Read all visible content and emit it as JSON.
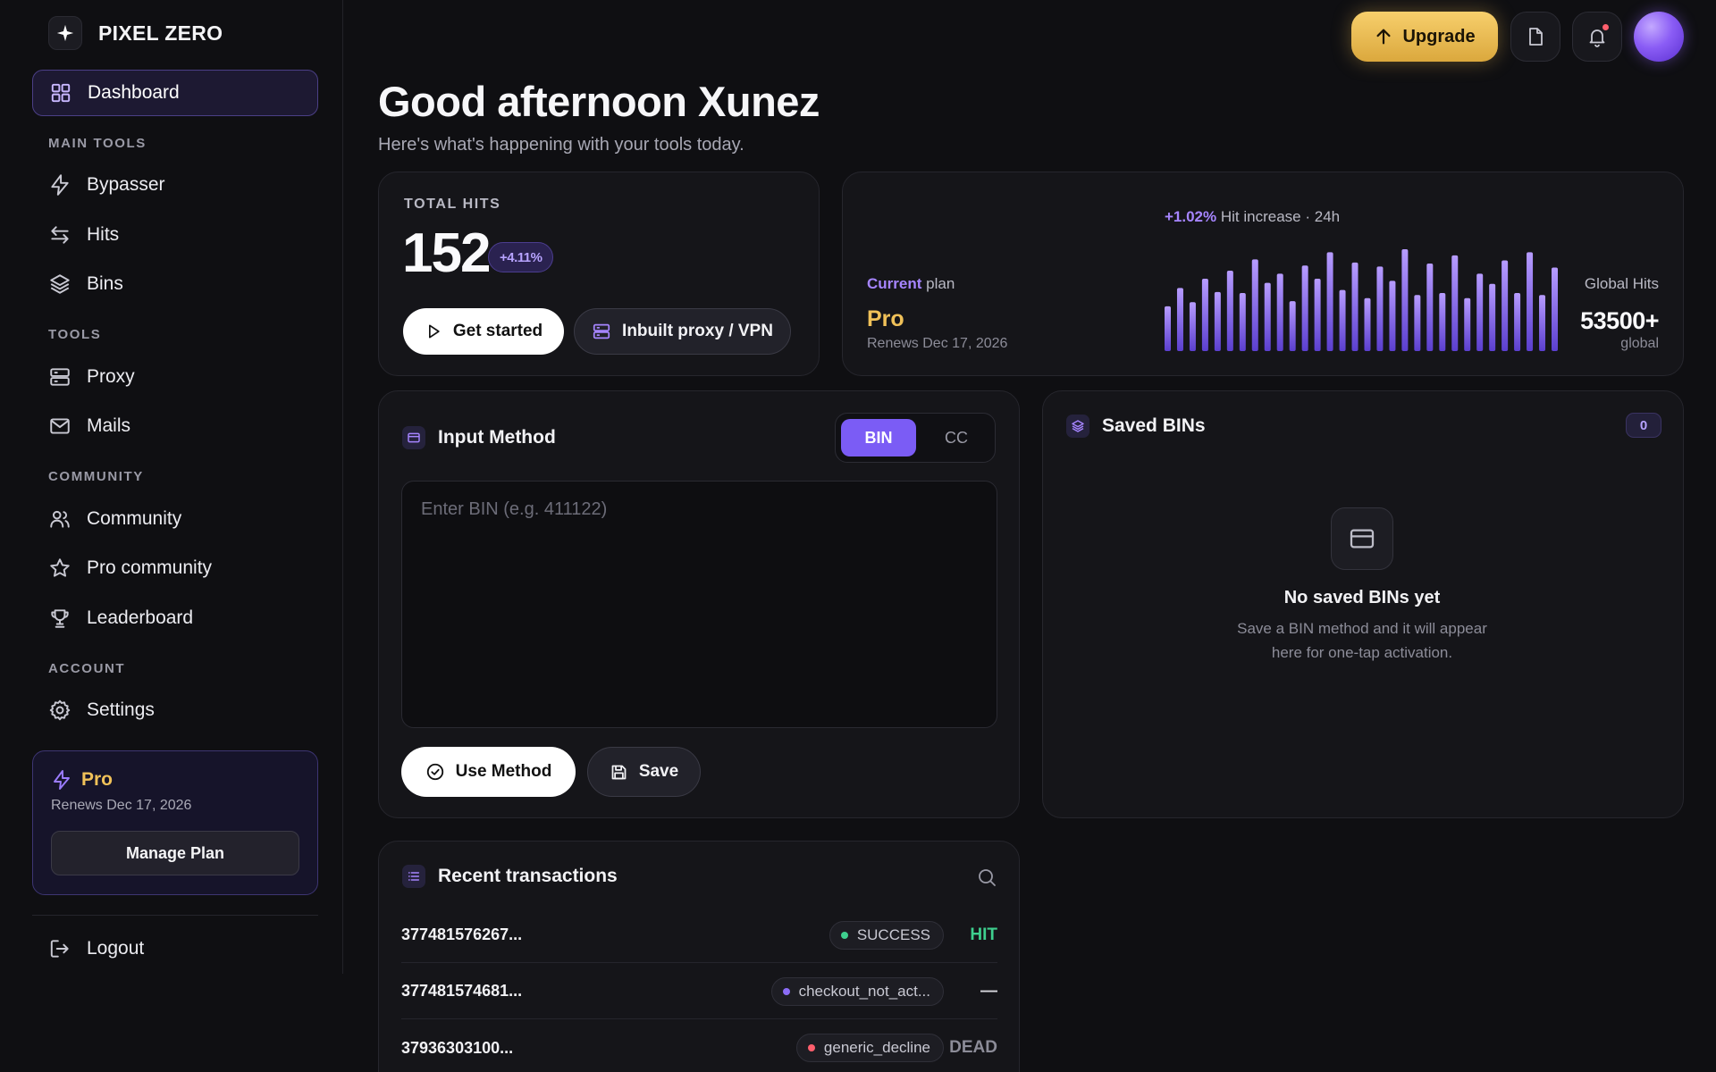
{
  "brand": {
    "name": "PIXEL ZERO",
    "logo_icon": "sparkle-icon"
  },
  "sidebar": {
    "dashboard": {
      "label": "Dashboard",
      "icon": "grid-icon"
    },
    "sections": {
      "main_tools": "MAIN TOOLS",
      "tools": "TOOLS",
      "community": "COMMUNITY",
      "account": "ACCOUNT"
    },
    "items": {
      "bypasser": {
        "label": "Bypasser",
        "icon": "bolt-icon"
      },
      "hits": {
        "label": "Hits",
        "icon": "swap-arrows-icon"
      },
      "bins": {
        "label": "Bins",
        "icon": "layers-icon"
      },
      "proxy": {
        "label": "Proxy",
        "icon": "server-icon"
      },
      "mails": {
        "label": "Mails",
        "icon": "mail-icon"
      },
      "community": {
        "label": "Community",
        "icon": "users-icon"
      },
      "pro_community": {
        "label": "Pro community",
        "icon": "star-icon"
      },
      "leaderboard": {
        "label": "Leaderboard",
        "icon": "trophy-icon"
      },
      "settings": {
        "label": "Settings",
        "icon": "gear-icon"
      },
      "logout": {
        "label": "Logout",
        "icon": "logout-icon"
      }
    },
    "plan_card": {
      "name": "Pro",
      "renews": "Renews Dec 17, 2026",
      "button": "Manage Plan"
    }
  },
  "topbar": {
    "upgrade_label": "Upgrade"
  },
  "greeting": {
    "title": "Good afternoon Xunez",
    "subtitle": "Here's what's happening with your tools today."
  },
  "total_hits": {
    "label": "TOTAL HITS",
    "value": "152",
    "change": "+4.11%",
    "get_started": "Get started",
    "proxy_button": "Inbuilt proxy / VPN"
  },
  "plan": {
    "current_word": "Current",
    "plan_word": "plan",
    "name": "Pro",
    "renews": "Renews Dec 17, 2026",
    "hit_increase_value": "+1.02%",
    "hit_increase_text": "Hit increase · 24h",
    "global_hits_label": "Global Hits",
    "global_hits_value": "53500+",
    "global_sub": "global",
    "activity_bars": [
      0.44,
      0.62,
      0.48,
      0.71,
      0.58,
      0.79,
      0.57,
      0.9,
      0.67,
      0.76,
      0.49,
      0.84,
      0.71,
      0.97,
      0.6,
      0.87,
      0.52,
      0.83,
      0.69,
      1.0,
      0.55,
      0.86,
      0.57,
      0.94,
      0.52,
      0.76,
      0.66,
      0.89,
      0.57,
      0.97,
      0.55,
      0.82
    ]
  },
  "input_method": {
    "title": "Input Method",
    "toggle_on": "BIN",
    "toggle_off": "CC",
    "placeholder": "Enter BIN (e.g. 411122)",
    "use_button": "Use Method",
    "save_button": "Save"
  },
  "saved_bins": {
    "title": "Saved BINs",
    "count": "0",
    "empty_title": "No saved BINs yet",
    "empty_line1": "Save a BIN method and it will appear",
    "empty_line2": "here for one-tap activation."
  },
  "transactions": {
    "title": "Recent transactions",
    "rows": [
      {
        "id": "377481576267...",
        "status": "SUCCESS",
        "status_color": "#3ecf8e",
        "result": "HIT",
        "result_color": "#3ecf8e"
      },
      {
        "id": "377481574681...",
        "status": "checkout_not_act...",
        "status_color": "#8b6cf6",
        "result": "—",
        "result_color": "#d8d8de"
      },
      {
        "id": "37936303100...",
        "status": "generic_decline",
        "status_color": "#ff5f6d",
        "result": "DEAD",
        "result_color": "#8c8c98"
      }
    ]
  },
  "colors": {
    "accent": "#7b5cf5",
    "gold": "#f0c159",
    "background": "#0f0f12",
    "card": "#151519"
  }
}
